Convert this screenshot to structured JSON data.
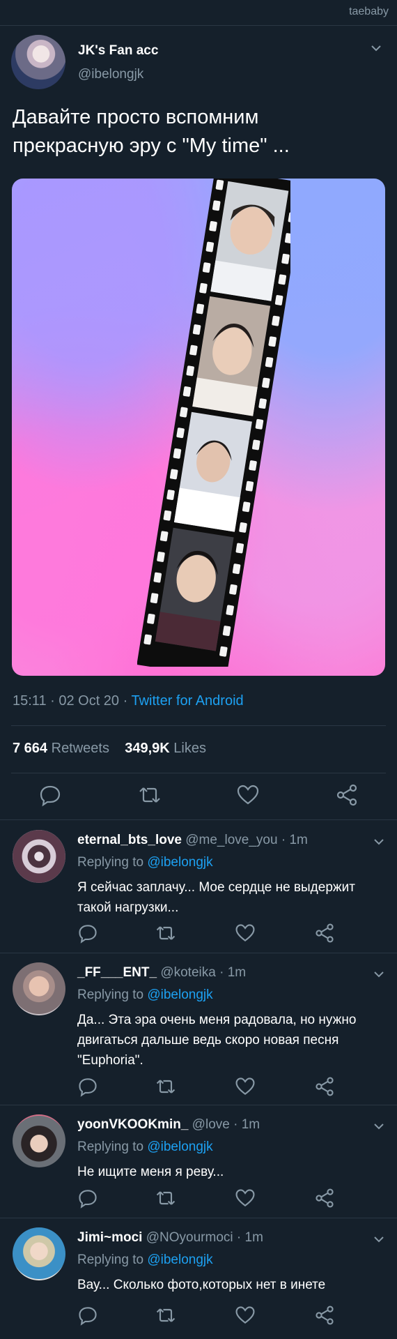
{
  "watermark": "taebaby",
  "tweet": {
    "author_name": "JK's Fan acc",
    "author_handle": "@ibelongjk",
    "text": "Давайте просто вспомним прекрасную эру с \"My time\" ...",
    "time": "15:11 · 02 Oct 20 · ",
    "source": "Twitter for Android",
    "retweets_count": "7 664",
    "retweets_label": " Retweets",
    "likes_count": "349,9K",
    "likes_label": " Likes"
  },
  "icons": [
    "reply-icon",
    "retweet-icon",
    "like-icon",
    "share-icon",
    "chevron-down-icon"
  ],
  "replies": [
    {
      "name": "eternal_bts_love",
      "handle": " @me_love_you",
      "time": " · 1m",
      "replying_prefix": "Replying to ",
      "replying_to": "@ibelongjk",
      "text": "Я сейчас заплачу... Мое сердце не выдержит такой нагрузки..."
    },
    {
      "name": "_FF___ENT_",
      "handle": " @koteika",
      "time": " · 1m",
      "replying_prefix": "Replying to ",
      "replying_to": "@ibelongjk",
      "text": "Да... Эта эра очень меня радовала, но нужно двигаться дальше ведь скоро новая песня \"Euphoria\"."
    },
    {
      "name": "yoonVKOOKmin_",
      "handle": " @love",
      "time": " · 1m",
      "replying_prefix": "Replying to ",
      "replying_to": "@ibelongjk",
      "text": "Не ищите меня я реву..."
    },
    {
      "name": "Jimi~moci",
      "handle": " @NOyourmoci",
      "time": " · 1m",
      "replying_prefix": "Replying to ",
      "replying_to": "@ibelongjk",
      "text": "Вау... Сколько фото,которых нет в инете"
    }
  ]
}
